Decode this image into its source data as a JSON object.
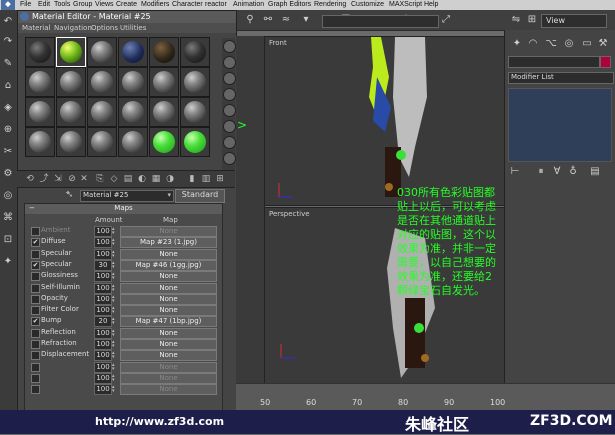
{
  "menubar": {
    "items": [
      "File",
      "Edit",
      "Tools",
      "Group",
      "Views",
      "Create",
      "Modifiers",
      "Character",
      "reactor",
      "Animation",
      "Graph Editors",
      "Rendering",
      "Customize",
      "MAXScript",
      "Help"
    ]
  },
  "material_editor": {
    "title": "Material Editor - Material #25",
    "menu": [
      "Material",
      "Navigation",
      "Options",
      "Utilities"
    ],
    "material_name": "Material #25",
    "material_type": "Standard",
    "maps_title": "Maps",
    "col_amount": "Amount",
    "col_map": "Map",
    "maps": [
      {
        "checked": false,
        "name": "Ambient",
        "amount": "100",
        "map": "None",
        "dim": true
      },
      {
        "checked": true,
        "name": "Diffuse",
        "amount": "100",
        "map": "Map #23 (1.jpg)",
        "dim": false
      },
      {
        "checked": false,
        "name": "Specular",
        "amount": "100",
        "map": "None",
        "dim": false
      },
      {
        "checked": true,
        "name": "Specular",
        "amount": "30",
        "map": "Map #46 (1gg.jpg)",
        "dim": false
      },
      {
        "checked": false,
        "name": "Glossiness",
        "amount": "100",
        "map": "None",
        "dim": false
      },
      {
        "checked": false,
        "name": "Self-Illumin",
        "amount": "100",
        "map": "None",
        "dim": false
      },
      {
        "checked": false,
        "name": "Opacity",
        "amount": "100",
        "map": "None",
        "dim": false
      },
      {
        "checked": false,
        "name": "Filter Color",
        "amount": "100",
        "map": "None",
        "dim": false
      },
      {
        "checked": true,
        "name": "Bump",
        "amount": "20",
        "map": "Map #47 (1bp.jpg)",
        "dim": false
      },
      {
        "checked": false,
        "name": "Reflection",
        "amount": "100",
        "map": "None",
        "dim": false
      },
      {
        "checked": false,
        "name": "Refraction",
        "amount": "100",
        "map": "None",
        "dim": false
      },
      {
        "checked": false,
        "name": "Displacement",
        "amount": "100",
        "map": "None",
        "dim": false
      },
      {
        "checked": false,
        "name": "",
        "amount": "100",
        "map": "None",
        "dim": true
      },
      {
        "checked": false,
        "name": "",
        "amount": "100",
        "map": "None",
        "dim": true
      },
      {
        "checked": false,
        "name": "",
        "amount": "100",
        "map": "None",
        "dim": true
      }
    ]
  },
  "viewports": {
    "front_label": "Front",
    "persp_label": "Perspective"
  },
  "toolbar": {
    "view_label": "View"
  },
  "command_panel": {
    "modifier_list": "Modifier List"
  },
  "timeline": {
    "ticks": [
      "50",
      "60",
      "70",
      "80",
      "90",
      "100"
    ]
  },
  "annotation": "030所有色彩贴图都\n贴上以后，可以考虑\n是否在其他通道贴上\n对应的贴图，这个以\n效果为准，并非一定\n需要，以自己想要的\n效果为准，还要给2\n颗绿宝石自发光。",
  "footer": {
    "url": "http://www.zf3d.com",
    "logo": "朱峰社区",
    "domain": "ZF3D.COM"
  },
  "colors": {
    "annotation": "#24ff24",
    "footer_bg": "#1e1e4a"
  }
}
